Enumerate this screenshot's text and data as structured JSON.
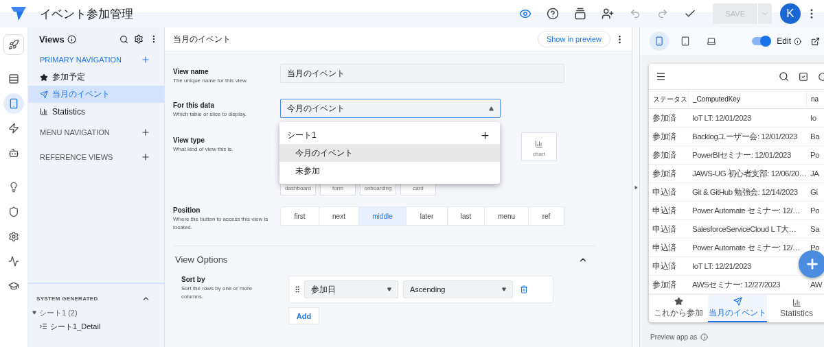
{
  "app": {
    "title": "イベント参加管理"
  },
  "toolbar": {
    "preview_selected": true,
    "save": {
      "label": "SAVE",
      "disabled": true
    },
    "avatar": "K"
  },
  "rail": [
    {
      "selected": false
    },
    {
      "selected": false
    },
    {
      "selected": true
    },
    {
      "selected": false
    },
    {
      "selected": false
    },
    {
      "selected": false
    },
    {
      "selected": false
    },
    {
      "selected": false
    },
    {
      "selected": false
    },
    {
      "selected": false
    }
  ],
  "sidebar": {
    "title": "Views",
    "sections": [
      {
        "label": "PRIMARY NAVIGATION",
        "active": true,
        "items": [
          {
            "label": "参加予定",
            "selected": false
          },
          {
            "label": "当月のイベント",
            "selected": true
          },
          {
            "label": "Statistics",
            "selected": false
          }
        ]
      },
      {
        "label": "MENU NAVIGATION",
        "active": false
      },
      {
        "label": "REFERENCE VIEWS",
        "active": false
      }
    ],
    "system": {
      "label": "SYSTEM GENERATED",
      "expanded": true,
      "tree": [
        {
          "label": "シート1 (2)",
          "expanded": true,
          "children": [
            {
              "label": "シート1_Detail"
            }
          ]
        }
      ]
    }
  },
  "editor": {
    "title": "当月のイベント",
    "show_in_preview": "Show in preview",
    "view_name": {
      "label": "View name",
      "hint": "The unique name for this view.",
      "value": "当月のイベント"
    },
    "for_this_data": {
      "label": "For this data",
      "hint": "Which table or slice to display.",
      "value": "今月のイベント",
      "open": true,
      "options": [
        {
          "kind": "group",
          "label": "シート1"
        },
        {
          "kind": "option",
          "label": "今月のイベント",
          "selected": true
        },
        {
          "kind": "option",
          "label": "未参加",
          "selected": false
        }
      ]
    },
    "view_type": {
      "label": "View type",
      "hint": "What kind of view this is.",
      "row_1": [
        "chart"
      ],
      "row_2": [
        "dashboard",
        "form",
        "onboarding",
        "card"
      ]
    },
    "position": {
      "label": "Position",
      "hint": "Where the button to access this view is located.",
      "options": [
        {
          "label": "first",
          "selected": false
        },
        {
          "label": "next",
          "selected": false
        },
        {
          "label": "middle",
          "selected": true
        },
        {
          "label": "later",
          "selected": false
        },
        {
          "label": "last",
          "selected": false
        },
        {
          "label": "menu",
          "selected": false
        },
        {
          "label": "ref",
          "selected": false
        }
      ]
    },
    "view_options": {
      "title": "View Options",
      "expanded": true,
      "sort_by": {
        "label": "Sort by",
        "hint": "Sort the rows by one or more columns.",
        "rules": [
          {
            "column": "参加日",
            "order": "Ascending"
          }
        ],
        "add": "Add"
      }
    }
  },
  "preview": {
    "devices": [
      {
        "selected": true
      },
      {
        "selected": false
      },
      {
        "selected": false
      }
    ],
    "edit": {
      "label": "Edit",
      "on": true
    },
    "table": {
      "columns": [
        "ステータス",
        "_ComputedKey",
        "na"
      ],
      "rows": [
        [
          "参加済",
          "IoT LT: 12/01/2023",
          "Io"
        ],
        [
          "参加済",
          "Backlogユーザー会: 12/01/2023",
          "Ba"
        ],
        [
          "参加済",
          "PowerBIセミナー: 12/01/2023",
          "Po"
        ],
        [
          "参加済",
          "JAWS-UG 初心者支部: 12/06/20…",
          "JA"
        ],
        [
          "申込済",
          "Git & GitHub 勉強会: 12/14/2023",
          "Gi"
        ],
        [
          "申込済",
          "Power Automate セミナー: 12/…",
          "Po"
        ],
        [
          "申込済",
          "SalesforceServiceCloud L T大…",
          "Sa"
        ],
        [
          "申込済",
          "Power Automate セミナー: 12/…",
          "Po"
        ],
        [
          "申込済",
          "IoT LT: 12/21/2023"
        ],
        [
          "参加済",
          "AWSセミナー: 12/27/2023",
          "AW"
        ]
      ]
    },
    "nav": [
      {
        "label": "これから参加",
        "selected": false
      },
      {
        "label": "当月のイベント",
        "selected": true
      },
      {
        "label": "Statistics",
        "selected": false
      }
    ],
    "preview_as": "Preview app as"
  }
}
